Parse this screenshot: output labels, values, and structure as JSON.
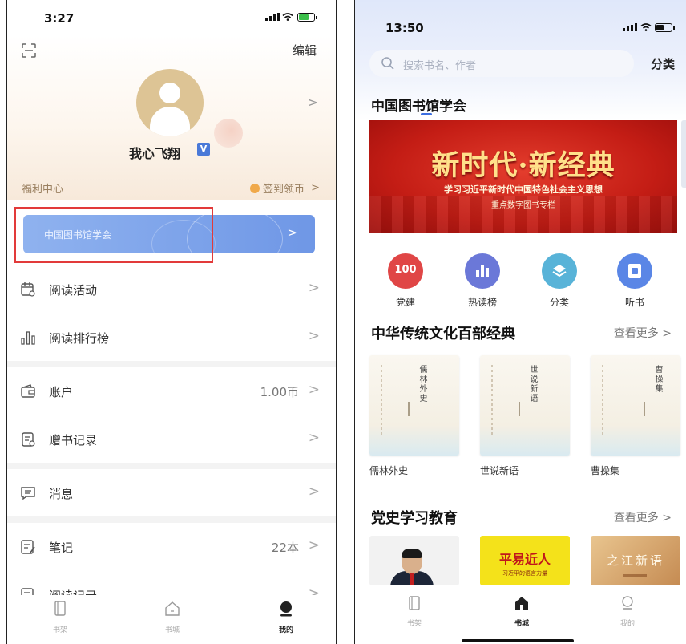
{
  "left_screen": {
    "status": {
      "time": "3:27"
    },
    "header": {
      "edit_label": "编辑"
    },
    "profile": {
      "username": "我心飞翔",
      "badge": "V"
    },
    "welfare": {
      "title": "福利中心",
      "signin_label": "签到领币"
    },
    "library_banner": {
      "label": "中国图书馆学会"
    },
    "menu": [
      {
        "label": "阅读活动",
        "value": "",
        "icon": "calendar-icon"
      },
      {
        "label": "阅读排行榜",
        "value": "",
        "icon": "bar-chart-icon"
      },
      {
        "label": "账户",
        "value": "1.00币",
        "icon": "wallet-icon"
      },
      {
        "label": "赠书记录",
        "value": "",
        "icon": "gift-record-icon"
      },
      {
        "label": "消息",
        "value": "",
        "icon": "message-icon"
      },
      {
        "label": "笔记",
        "value": "22本",
        "icon": "note-icon"
      },
      {
        "label": "阅读记录",
        "value": "",
        "icon": "history-icon"
      }
    ],
    "tabbar": [
      {
        "label": "书架",
        "icon": "bookshelf-icon",
        "active": false
      },
      {
        "label": "书城",
        "icon": "home-icon",
        "active": false
      },
      {
        "label": "我的",
        "icon": "user-icon",
        "active": true
      }
    ]
  },
  "right_screen": {
    "status": {
      "time": "13:50"
    },
    "search": {
      "placeholder": "搜索书名、作者"
    },
    "category_label": "分类",
    "section_title": "中国图书馆学会",
    "hero_banner": {
      "title": "新时代·新经典",
      "subtitle1": "学习习近平新时代中国特色社会主义思想",
      "subtitle2": "重点数字图书专栏"
    },
    "quick_links": [
      {
        "label": "党建",
        "icon": "party-icon",
        "color": "#e04646"
      },
      {
        "label": "热读榜",
        "icon": "chart-icon",
        "color": "#6b78d8"
      },
      {
        "label": "分类",
        "icon": "layers-icon",
        "color": "#58b3d8"
      },
      {
        "label": "听书",
        "icon": "audio-book-icon",
        "color": "#5a86e6"
      }
    ],
    "classics": {
      "title": "中华传统文化百部经典",
      "more_label": "查看更多 >",
      "books": [
        {
          "title": "儒林外史",
          "cover_text": "儒林外史"
        },
        {
          "title": "世说新语",
          "cover_text": "世说新语"
        },
        {
          "title": "曹操集",
          "cover_text": "曹操集"
        }
      ]
    },
    "party_history": {
      "title": "党史学习教育",
      "more_label": "查看更多 >",
      "books": [
        {
          "cover_text": ""
        },
        {
          "cover_text": "平易近人",
          "cover_sub": "习近平的语言力量"
        },
        {
          "cover_text": "之江新语"
        }
      ]
    },
    "tabbar": [
      {
        "label": "书架",
        "icon": "bookshelf-icon",
        "active": false
      },
      {
        "label": "书城",
        "icon": "home-icon",
        "active": true
      },
      {
        "label": "我的",
        "icon": "user-icon",
        "active": false
      }
    ]
  }
}
